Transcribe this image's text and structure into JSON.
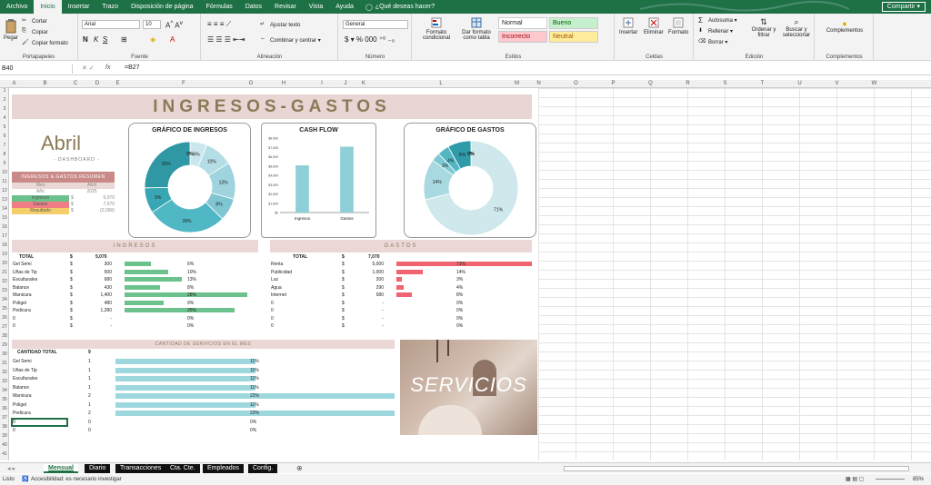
{
  "menu": {
    "tabs": [
      "Archivo",
      "Inicio",
      "Insertar",
      "Trazo",
      "Disposición de página",
      "Fórmulas",
      "Datos",
      "Revisar",
      "Vista",
      "Ayuda"
    ],
    "active_tab": "Inicio",
    "tell_me": "¿Qué deseas hacer?",
    "share": "Compartir"
  },
  "ribbon": {
    "clipboard": {
      "paste": "Pegar",
      "cut": "Cortar",
      "copy": "Copiar",
      "format_painter": "Copiar formato",
      "label": "Portapapeles"
    },
    "font": {
      "name": "Arial",
      "size": "10",
      "label": "Fuente"
    },
    "alignment": {
      "wrap": "Ajustar texto",
      "merge": "Combinar y centrar",
      "label": "Alineación"
    },
    "number": {
      "format": "General",
      "label": "Número"
    },
    "styles": {
      "conditional": "Formato condicional",
      "table": "Dar formato como tabla",
      "normal": "Normal",
      "good": "Bueno",
      "bad": "Incorrecto",
      "neutral": "Neutral",
      "label": "Estilos"
    },
    "cells": {
      "insert": "Insertar",
      "delete": "Eliminar",
      "format": "Formato",
      "label": "Celdas"
    },
    "editing": {
      "autosum": "Autosuma",
      "fill": "Rellenar",
      "clear": "Borrar",
      "sort": "Ordenar y filtrar",
      "find": "Buscar y seleccionar",
      "label": "Edición"
    },
    "addins": {
      "label": "Complementos",
      "button": "Complementos"
    }
  },
  "formula_bar": {
    "name_box": "B40",
    "fx": "fx",
    "formula": "=B27"
  },
  "columns": [
    "A",
    "B",
    "C",
    "D",
    "E",
    "F",
    "G",
    "H",
    "I",
    "J",
    "K",
    "L",
    "M",
    "N",
    "O",
    "P",
    "Q",
    "R",
    "S",
    "T",
    "U",
    "V",
    "W"
  ],
  "sheet": {
    "banner": "INGRESOS-GASTOS",
    "month": "Abril",
    "dashboard": "- DASHBOARD -",
    "summary": {
      "title": "INGRESOS & GASTOS RESUMEN",
      "head": [
        "Mes",
        "Abril"
      ],
      "year": [
        "Año",
        "2025"
      ],
      "rows": [
        {
          "label": "Ingresos",
          "cur": "$",
          "value": "5,070"
        },
        {
          "label": "Gastos",
          "cur": "$",
          "value": "7,070"
        },
        {
          "label": "Resultado",
          "cur": "$",
          "value": "(2,000)"
        }
      ]
    },
    "income_section": "INGRESOS",
    "expense_section": "GASTOS",
    "income_total": {
      "label": "TOTAL",
      "cur": "$",
      "value": "5,070"
    },
    "expense_total": {
      "label": "TOTAL",
      "cur": "$",
      "value": "7,070"
    },
    "income_rows": [
      {
        "name": "Gel Semi",
        "cur": "$",
        "value": "300",
        "pct": "6%"
      },
      {
        "name": "Uñas de Tip",
        "cur": "$",
        "value": "500",
        "pct": "10%"
      },
      {
        "name": "Esculturales",
        "cur": "$",
        "value": "680",
        "pct": "13%"
      },
      {
        "name": "Balance",
        "cur": "$",
        "value": "430",
        "pct": "8%"
      },
      {
        "name": "Manicura",
        "cur": "$",
        "value": "1,400",
        "pct": "28%"
      },
      {
        "name": "Poligel",
        "cur": "$",
        "value": "480",
        "pct": "9%"
      },
      {
        "name": "Pedicura",
        "cur": "$",
        "value": "1,280",
        "pct": "25%"
      },
      {
        "name": "0",
        "cur": "$",
        "value": "-",
        "pct": "0%"
      },
      {
        "name": "0",
        "cur": "$",
        "value": "-",
        "pct": "0%"
      }
    ],
    "expense_rows": [
      {
        "name": "Renta",
        "cur": "$",
        "value": "5,000",
        "pct": "71%"
      },
      {
        "name": "Publicidad",
        "cur": "$",
        "value": "1,000",
        "pct": "14%"
      },
      {
        "name": "Luz",
        "cur": "$",
        "value": "200",
        "pct": "3%"
      },
      {
        "name": "Agua",
        "cur": "$",
        "value": "290",
        "pct": "4%"
      },
      {
        "name": "Internet",
        "cur": "$",
        "value": "580",
        "pct": "8%"
      },
      {
        "name": "0",
        "cur": "$",
        "value": "-",
        "pct": "0%"
      },
      {
        "name": "0",
        "cur": "$",
        "value": "-",
        "pct": "0%"
      },
      {
        "name": "0",
        "cur": "$",
        "value": "-",
        "pct": "0%"
      },
      {
        "name": "0",
        "cur": "$",
        "value": "-",
        "pct": "0%"
      }
    ],
    "services_section": "CANTIDAD DE SERVICIOS EN EL MES",
    "services_total": {
      "label": "CANTIDAD TOTAL",
      "value": "9"
    },
    "services_rows": [
      {
        "name": "Gel Semi",
        "count": "1",
        "pct": "11%"
      },
      {
        "name": "Uñas de Tip",
        "count": "1",
        "pct": "11%"
      },
      {
        "name": "Esculturales",
        "count": "1",
        "pct": "11%"
      },
      {
        "name": "Balance",
        "count": "1",
        "pct": "11%"
      },
      {
        "name": "Manicura",
        "count": "2",
        "pct": "22%"
      },
      {
        "name": "Poligel",
        "count": "1",
        "pct": "11%"
      },
      {
        "name": "Pedicura",
        "count": "2",
        "pct": "22%"
      },
      {
        "name": "0",
        "count": "0",
        "pct": "0%"
      },
      {
        "name": "0",
        "count": "0",
        "pct": "0%"
      }
    ],
    "servicios_image_text": "SERVICIOS"
  },
  "chart_data": [
    {
      "type": "pie",
      "title": "GRÁFICO DE INGRESOS",
      "categories": [
        "Gel Semi",
        "Uñas de Tip",
        "Esculturales",
        "Balance",
        "Manicura",
        "Poligel",
        "Pedicura",
        "0",
        "0"
      ],
      "values": [
        6,
        10,
        13,
        8,
        28,
        9,
        25,
        0,
        0
      ],
      "labels": [
        "6%",
        "10%",
        "13%",
        "8%",
        "28%",
        "9%",
        "25%",
        "0%",
        "0%"
      ],
      "colors": [
        "#c9e7ec",
        "#b5dde5",
        "#9fd3dd",
        "#7fc6d2",
        "#4fb8c4",
        "#39a7b3",
        "#2f98a4",
        "#2b8a95",
        "#2a7c86"
      ]
    },
    {
      "type": "bar",
      "title": "CASH FLOW",
      "categories": [
        "Ingresos",
        "Gastos"
      ],
      "values": [
        5070,
        7070
      ],
      "ylim": [
        0,
        8000
      ],
      "yticks": [
        "$0",
        "$1,000",
        "$2,000",
        "$3,000",
        "$4,000",
        "$5,000",
        "$6,000",
        "$7,000",
        "$8,000"
      ],
      "color": "#8fd0d8"
    },
    {
      "type": "pie",
      "title": "GRÁFICO DE GASTOS",
      "categories": [
        "Renta",
        "Publicidad",
        "Luz",
        "Agua",
        "Internet",
        "0",
        "0",
        "0",
        "0"
      ],
      "values": [
        71,
        14,
        3,
        4,
        8,
        0,
        0,
        0,
        0
      ],
      "labels": [
        "71%",
        "14%",
        "3%",
        "4%",
        "8%",
        "0%",
        "0%",
        "0%",
        "0%"
      ],
      "colors": [
        "#cfe8ec",
        "#a8d8e0",
        "#7fc9d4",
        "#52b6c3",
        "#2f9aa8",
        "#2a8a96",
        "#267e89",
        "#23727c",
        "#20666f"
      ]
    }
  ],
  "sheet_tabs": [
    "Mensual",
    "Diario",
    "Transacciones",
    "Cta. Cte.",
    "Empleados",
    "Config."
  ],
  "active_sheet": "Mensual",
  "status": {
    "ready": "Listo",
    "accessibility": "Accesibilidad: es necesario investigar",
    "zoom": "85%"
  }
}
